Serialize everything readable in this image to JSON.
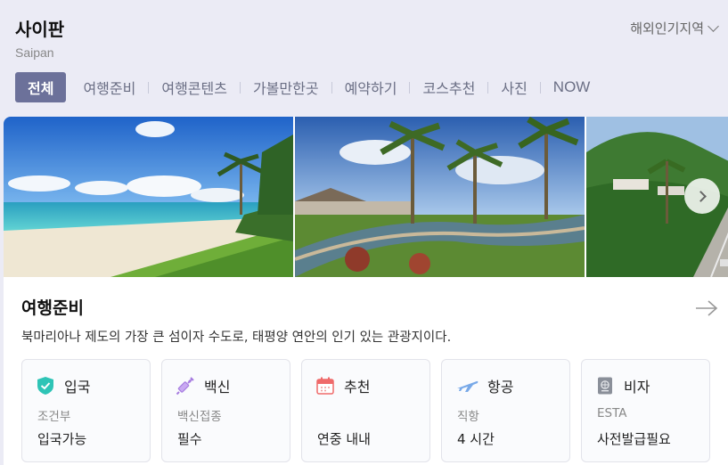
{
  "header": {
    "title": "사이판",
    "subtitle": "Saipan",
    "region_select": "해외인기지역"
  },
  "tabs": [
    {
      "label": "전체",
      "active": true
    },
    {
      "label": "여행준비"
    },
    {
      "label": "여행콘텐츠"
    },
    {
      "label": "가볼만한곳"
    },
    {
      "label": "예약하기"
    },
    {
      "label": "코스추천"
    },
    {
      "label": "사진"
    },
    {
      "label": "NOW"
    }
  ],
  "section": {
    "title": "여행준비",
    "description": "북마리아나 제도의 가장 큰 섬이자 수도로, 태평양 연안의 인기 있는 관광지이다."
  },
  "info_cards": [
    {
      "icon": "shield-check-icon",
      "title": "입국",
      "key": "조건부",
      "value": "입국가능"
    },
    {
      "icon": "syringe-icon",
      "title": "백신",
      "key": "백신접종",
      "value": "필수"
    },
    {
      "icon": "calendar-icon",
      "title": "추천",
      "key": "",
      "value": "연중 내내"
    },
    {
      "icon": "airplane-icon",
      "title": "항공",
      "key": "직항",
      "value": "4 시간"
    },
    {
      "icon": "passport-icon",
      "title": "비자",
      "key": "ESTA",
      "value": "사전발급필요"
    }
  ],
  "colors": {
    "background": "#ebebf5",
    "active_tab": "#6c719a",
    "tab_text": "#6b6f85",
    "shield": "#2ec4b6",
    "syringe": "#a77ce0",
    "calendar": "#ef6a6a",
    "airplane": "#78a9e8",
    "passport": "#8a8f99"
  }
}
